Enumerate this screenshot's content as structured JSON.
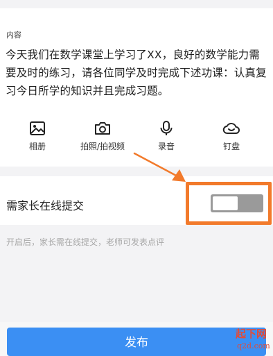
{
  "content": {
    "section_label": "内容",
    "text": "今天我们在数学课堂上学习了XX，良好的数学能力需要及时的练习，请各位同学及时完成下述功课：认真复习今日所学的知识并且完成习题。"
  },
  "attachments": [
    {
      "label": "相册",
      "icon": "image-icon"
    },
    {
      "label": "拍照/拍视频",
      "icon": "camera-icon"
    },
    {
      "label": "录音",
      "icon": "microphone-icon"
    },
    {
      "label": "钉盘",
      "icon": "cloud-icon"
    }
  ],
  "parent_submit": {
    "label": "需家长在线提交",
    "enabled": false,
    "hint": "开启后，家长需在线提交，老师可发表点评"
  },
  "annotation": {
    "arrow_color": "#f27a2b",
    "box_color": "#f27a2b"
  },
  "footer": {
    "publish_label": "发布",
    "accent": "#3b8ff3"
  },
  "watermark": {
    "top": "起下网",
    "bottom": "q2d.com"
  }
}
